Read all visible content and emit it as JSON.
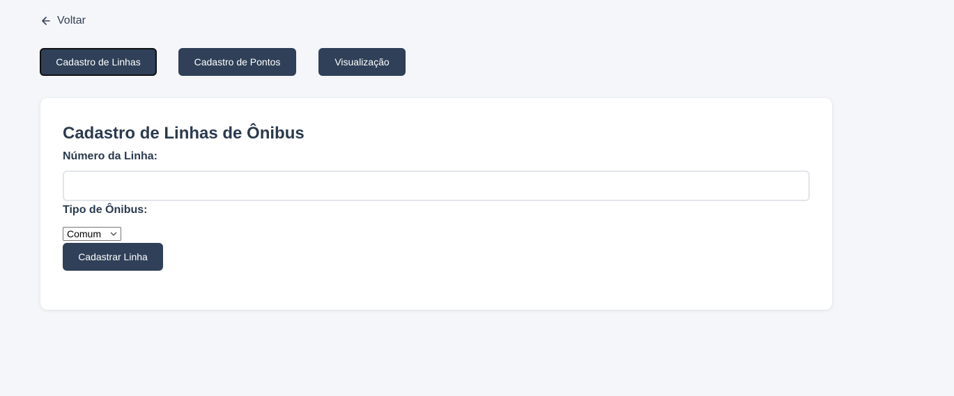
{
  "nav": {
    "back_label": "Voltar",
    "back_icon": "arrow-left-icon"
  },
  "tabs": [
    {
      "label": "Cadastro de Linhas",
      "active": true
    },
    {
      "label": "Cadastro de Pontos",
      "active": false
    },
    {
      "label": "Visualização",
      "active": false
    }
  ],
  "form": {
    "title": "Cadastro de Linhas de Ônibus",
    "line_number_label": "Número da Linha:",
    "line_number_value": "",
    "bus_type_label": "Tipo de Ônibus:",
    "bus_type_selected": "Comum",
    "select_icon": "chevron-down-icon",
    "submit_label": "Cadastrar Linha"
  },
  "colors": {
    "background": "#f5f6f9",
    "button": "#2f4058",
    "button_text": "#ffffff",
    "text": "#2b3a4e",
    "card": "#ffffff"
  }
}
